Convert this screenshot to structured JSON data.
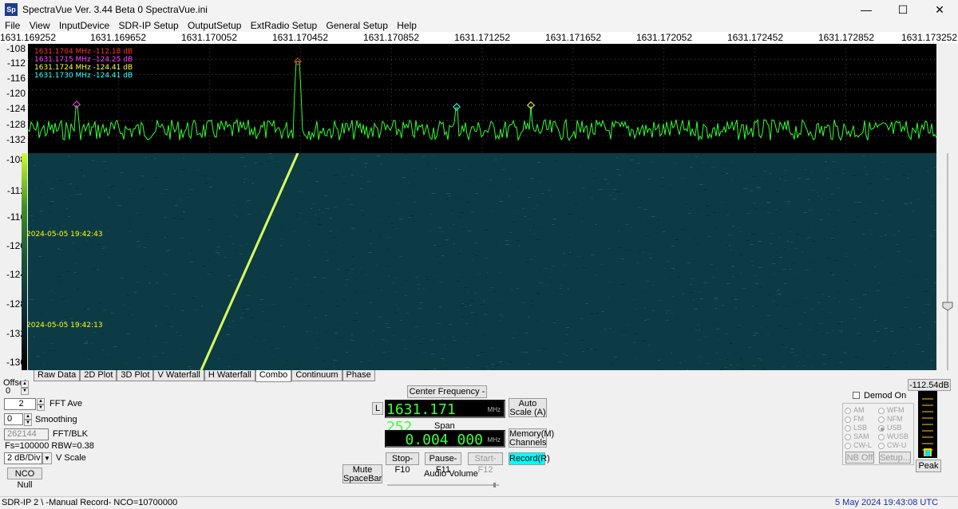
{
  "window": {
    "title": "SpectraVue Ver. 3.44 Beta 0    SpectraVue.ini",
    "icon_text": "Sp",
    "minimize": "—",
    "maximize": "☐",
    "close": "✕"
  },
  "menu": [
    "File",
    "View",
    "InputDevice",
    "SDR-IP Setup",
    "OutputSetup",
    "ExtRadio Setup",
    "General Setup",
    "Help"
  ],
  "freq_axis": [
    "1631.169252",
    "1631.169652",
    "1631.170052",
    "1631.170452",
    "1631.170852",
    "1631.171252",
    "1631.171652",
    "1631.172052",
    "1631.172452",
    "1631.172852",
    "1631.173252"
  ],
  "spectrum": {
    "db_labels": [
      "-108",
      "-112",
      "-116",
      "-120",
      "-124",
      "-128",
      "-132"
    ],
    "markers": [
      {
        "text": "1631.1704 MHz  -112.18 dB",
        "color": "#ff3030"
      },
      {
        "text": "1631.1715 MHz  -124.25 dB",
        "color": "#ff40ff"
      },
      {
        "text": "1631.1724 MHz  -124.41 dB",
        "color": "#ffff40"
      },
      {
        "text": "1631.1730 MHz  -124.41 dB",
        "color": "#40ffff"
      }
    ]
  },
  "waterfall": {
    "db_labels": [
      "-108",
      "-112",
      "-116",
      "-120",
      "-124",
      "-128",
      "-132",
      "-136"
    ],
    "timestamps": [
      "2024-05-05 19:42:43",
      "2024-05-05 19:42:13"
    ]
  },
  "tabs": [
    "Raw Data",
    "2D Plot",
    "3D Plot",
    "V Waterfall",
    "H Waterfall",
    "Combo",
    "Continuum",
    "Phase"
  ],
  "active_tab": "Combo",
  "left_panel": {
    "offset_label": "Offset",
    "offset_value": "0",
    "fft_ave_value": "2",
    "fft_ave_label": "FFT Ave",
    "smoothing_value": "0",
    "smoothing_label": "Smoothing",
    "fft_blk_value": "262144",
    "fft_blk_label": "FFT/BLK",
    "fs_text": "Fs=100000 RBW=0.38",
    "vscale_value": "2 dB/Div",
    "vscale_label": "V Scale",
    "nco_null": "NCO Null"
  },
  "center": {
    "center_freq_button": "Center Frequency - Ins",
    "l_button": "L",
    "center_freq": "1631.171 252",
    "freq_unit": "MHz",
    "auto_scale": "Auto Scale (A)",
    "span_label": "Span",
    "span": "0.004 000",
    "span_unit": "MHz",
    "memory": "Memory(M) Channels",
    "mute": "Mute SpaceBar",
    "stop": "Stop-F10",
    "pause": "Pause-F11",
    "start": "Start-F12",
    "record": "Record(R)",
    "audio_volume": "Audio Volume"
  },
  "demod": {
    "demod_on": "Demod On",
    "level": "-112.54dB",
    "modes_left": [
      "AM",
      "FM",
      "LSB",
      "SAM",
      "CW-L"
    ],
    "modes_right": [
      "WFM",
      "NFM",
      "USB",
      "WUSB",
      "CW-U"
    ],
    "selected": "USB",
    "nb_off": "NB Off",
    "setup": "Setup...",
    "peak": "Peak"
  },
  "status": {
    "left": "SDR-IP 2  \\  -Manual Record-     NCO=10700000",
    "right": "5 May 2024  19:43:08 UTC",
    "right_color": "#1a2f9a"
  },
  "colors": {
    "trace": "#33ff33",
    "waterfall_bg": "#0d3b45",
    "signal_line": "#d8ff60"
  }
}
